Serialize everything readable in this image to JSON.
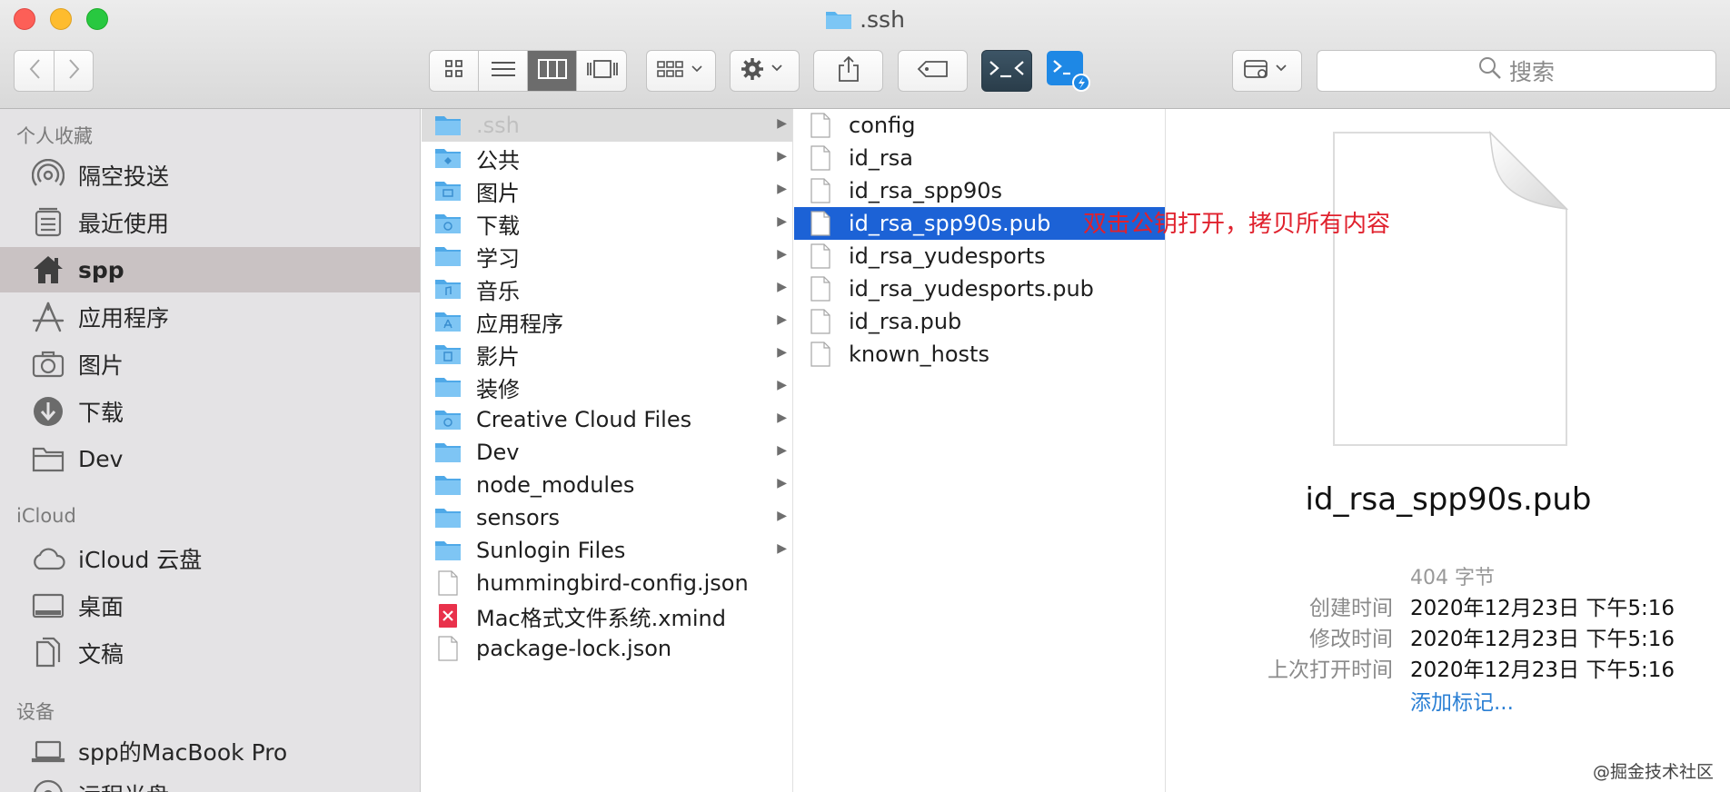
{
  "window": {
    "title": ".ssh"
  },
  "toolbar": {
    "buttons": [
      "back-icon",
      "forward-icon",
      "icon-view-icon",
      "list-view-icon",
      "column-view-icon",
      "gallery-view-icon",
      "group-icon",
      "action-gear-icon",
      "share-icon",
      "tag-icon",
      "terminal-icon",
      "vscode-icon",
      "path-icon"
    ],
    "search_placeholder": "搜索",
    "active_view": "column"
  },
  "sidebar": {
    "favorites_header": "个人收藏",
    "favorites": [
      {
        "label": "隔空投送",
        "icon": "airdrop-icon"
      },
      {
        "label": "最近使用",
        "icon": "recents-icon"
      },
      {
        "label": "spp",
        "icon": "home-icon",
        "selected": true
      },
      {
        "label": "应用程序",
        "icon": "applications-icon"
      },
      {
        "label": "图片",
        "icon": "camera-icon"
      },
      {
        "label": "下载",
        "icon": "download-icon"
      },
      {
        "label": "Dev",
        "icon": "folder-icon"
      }
    ],
    "icloud_header": "iCloud",
    "icloud": [
      {
        "label": "iCloud 云盘",
        "icon": "cloud-icon"
      },
      {
        "label": "桌面",
        "icon": "desktop-icon"
      },
      {
        "label": "文稿",
        "icon": "documents-icon"
      }
    ],
    "devices_header": "设备",
    "devices": [
      {
        "label": "spp的MacBook Pro",
        "icon": "laptop-icon"
      },
      {
        "label": "远程光盘",
        "icon": "disc-icon"
      }
    ]
  },
  "column1": {
    "items": [
      {
        "label": ".ssh",
        "type": "folder",
        "arrow": true,
        "state": "selected-gray"
      },
      {
        "label": "公共",
        "type": "folder",
        "arrow": true
      },
      {
        "label": "图片",
        "type": "folder",
        "arrow": true
      },
      {
        "label": "下载",
        "type": "folder",
        "arrow": true
      },
      {
        "label": "学习",
        "type": "folder",
        "arrow": true
      },
      {
        "label": "音乐",
        "type": "folder",
        "arrow": true
      },
      {
        "label": "应用程序",
        "type": "folder",
        "arrow": true
      },
      {
        "label": "影片",
        "type": "folder",
        "arrow": true
      },
      {
        "label": "装修",
        "type": "folder",
        "arrow": true
      },
      {
        "label": "Creative Cloud Files",
        "type": "folder",
        "arrow": true
      },
      {
        "label": "Dev",
        "type": "folder",
        "arrow": true
      },
      {
        "label": "node_modules",
        "type": "folder",
        "arrow": true
      },
      {
        "label": "sensors",
        "type": "folder",
        "arrow": true
      },
      {
        "label": "Sunlogin Files",
        "type": "folder",
        "arrow": true
      },
      {
        "label": "hummingbird-config.json",
        "type": "file",
        "arrow": false
      },
      {
        "label": "Mac格式文件系统.xmind",
        "type": "xmind",
        "arrow": false
      },
      {
        "label": "package-lock.json",
        "type": "file",
        "arrow": false
      }
    ]
  },
  "column2": {
    "items": [
      {
        "label": "config"
      },
      {
        "label": "id_rsa"
      },
      {
        "label": "id_rsa_spp90s"
      },
      {
        "label": "id_rsa_spp90s.pub",
        "selected": true
      },
      {
        "label": "id_rsa_yudesports"
      },
      {
        "label": "id_rsa_yudesports.pub"
      },
      {
        "label": "id_rsa.pub"
      },
      {
        "label": "known_hosts"
      }
    ]
  },
  "annotation": "双击公钥打开，拷贝所有内容",
  "preview": {
    "filename": "id_rsa_spp90s.pub",
    "size": "404 字节",
    "fields": [
      {
        "label": "创建时间",
        "value": "2020年12月23日 下午5:16"
      },
      {
        "label": "修改时间",
        "value": "2020年12月23日 下午5:16"
      },
      {
        "label": "上次打开时间",
        "value": "2020年12月23日 下午5:16"
      }
    ],
    "add_tags": "添加标记..."
  },
  "watermark": "@掘金技术社区",
  "colors": {
    "selection_blue": "#1c62d6",
    "annotation_red": "#e0212d",
    "folder_blue": "#5ab4ee",
    "sidebar_bg": "#e4e3e5"
  }
}
